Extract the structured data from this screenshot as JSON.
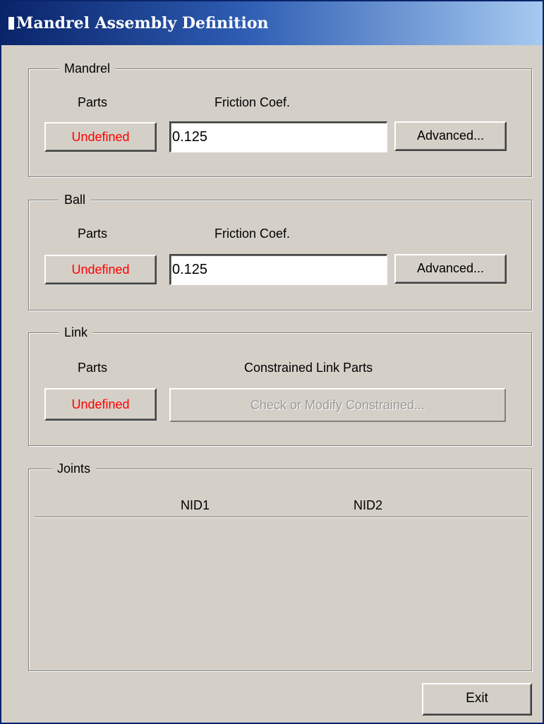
{
  "window": {
    "title": "Mandrel Assembly Definition"
  },
  "mandrel": {
    "legend": "Mandrel",
    "parts_label": "Parts",
    "friction_label": "Friction Coef.",
    "parts_button": "Undefined",
    "friction_value": "0.125",
    "advanced_button": "Advanced..."
  },
  "ball": {
    "legend": "Ball",
    "parts_label": "Parts",
    "friction_label": "Friction Coef.",
    "parts_button": "Undefined",
    "friction_value": "0.125",
    "advanced_button": "Advanced..."
  },
  "link": {
    "legend": "Link",
    "parts_label": "Parts",
    "constrained_label": "Constrained Link Parts",
    "parts_button": "Undefined",
    "constrained_button": "Check or Modify Constrained..."
  },
  "joints": {
    "legend": "Joints",
    "columns": [
      "NID1",
      "NID2"
    ]
  },
  "footer": {
    "exit_button": "Exit"
  },
  "colors": {
    "title_start": "#0a246a",
    "title_end": "#a6caf0",
    "undefined_text": "#ff0000",
    "face": "#d4d0c8"
  }
}
